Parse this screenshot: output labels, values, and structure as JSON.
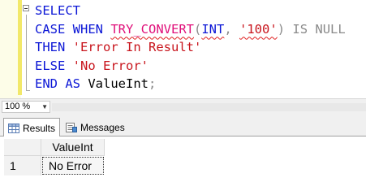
{
  "editor": {
    "lines": [
      {
        "segments": [
          {
            "text": "SELECT",
            "cls": "kw"
          }
        ]
      },
      {
        "segments": [
          {
            "text": "CASE WHEN ",
            "cls": "kw"
          },
          {
            "text": "TRY_CONVERT",
            "cls": "fn squig"
          },
          {
            "text": "(",
            "cls": "op"
          },
          {
            "text": "INT",
            "cls": "kw squig"
          },
          {
            "text": ",",
            "cls": "op"
          },
          {
            "text": " ",
            "cls": ""
          },
          {
            "text": "'100'",
            "cls": "str squig"
          },
          {
            "text": ")",
            "cls": "op"
          },
          {
            "text": " IS NULL",
            "cls": "gray"
          }
        ]
      },
      {
        "segments": [
          {
            "text": "THEN ",
            "cls": "kw"
          },
          {
            "text": "'Error In Result'",
            "cls": "str"
          }
        ]
      },
      {
        "segments": [
          {
            "text": "ELSE ",
            "cls": "kw"
          },
          {
            "text": "'No Error'",
            "cls": "str"
          }
        ]
      },
      {
        "segments": [
          {
            "text": "END AS ",
            "cls": "kw"
          },
          {
            "text": "ValueInt",
            "cls": ""
          },
          {
            "text": ";",
            "cls": "op"
          }
        ]
      }
    ]
  },
  "zoom": {
    "value": "100 %"
  },
  "tabs": {
    "results": "Results",
    "messages": "Messages"
  },
  "grid": {
    "columns": [
      "ValueInt"
    ],
    "rows": [
      {
        "num": "1",
        "cells": [
          "No Error"
        ]
      }
    ]
  },
  "colors": {
    "keyword": "#0b16d6",
    "function": "#e0107a",
    "string": "#c8141c",
    "operator": "#8a8a8a"
  },
  "icons": {
    "results_tab": "grid-icon",
    "messages_tab": "messages-icon",
    "zoom_dropdown": "chevron-down-icon"
  }
}
